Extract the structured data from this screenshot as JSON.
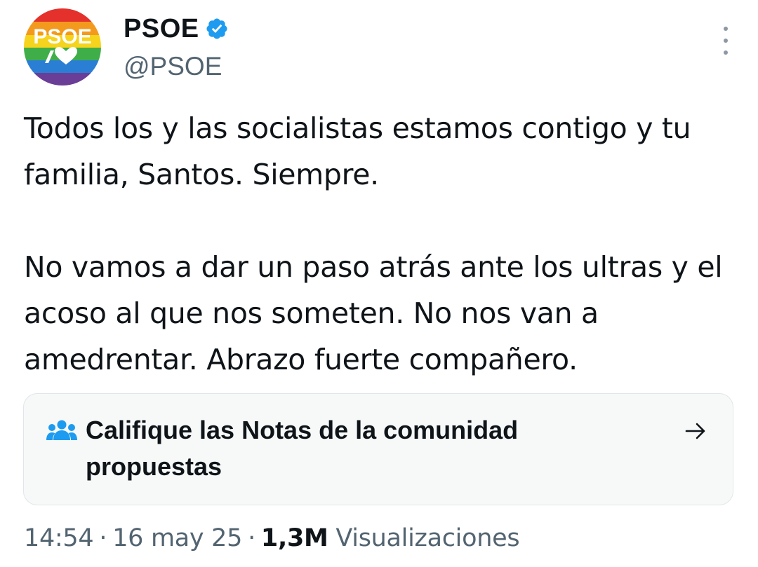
{
  "author": {
    "display_name": "PSOE",
    "handle": "@PSOE",
    "avatar_text": "PSOE"
  },
  "tweet": {
    "paragraphs": [
      "Todos los y las socialistas estamos contigo y tu familia, Santos. Siempre.",
      "No vamos a dar un paso atrás ante los ultras y el acoso al que nos someten. No nos van a amedrentar. Abrazo fuerte compañero."
    ]
  },
  "community_notes": {
    "label": "Califique las Notas de la comunidad propuestas"
  },
  "meta": {
    "time": "14:54",
    "date": "16 may 25",
    "views_count": "1,3M",
    "views_label": "Visualizaciones",
    "separator": "·"
  },
  "colors": {
    "accent": "#1d9bf0",
    "secondary_text": "#536471",
    "card_background": "#f7f9f9"
  },
  "icons": [
    "verified-badge-icon",
    "more-options-icon",
    "community-notes-icon",
    "arrow-right-icon"
  ]
}
